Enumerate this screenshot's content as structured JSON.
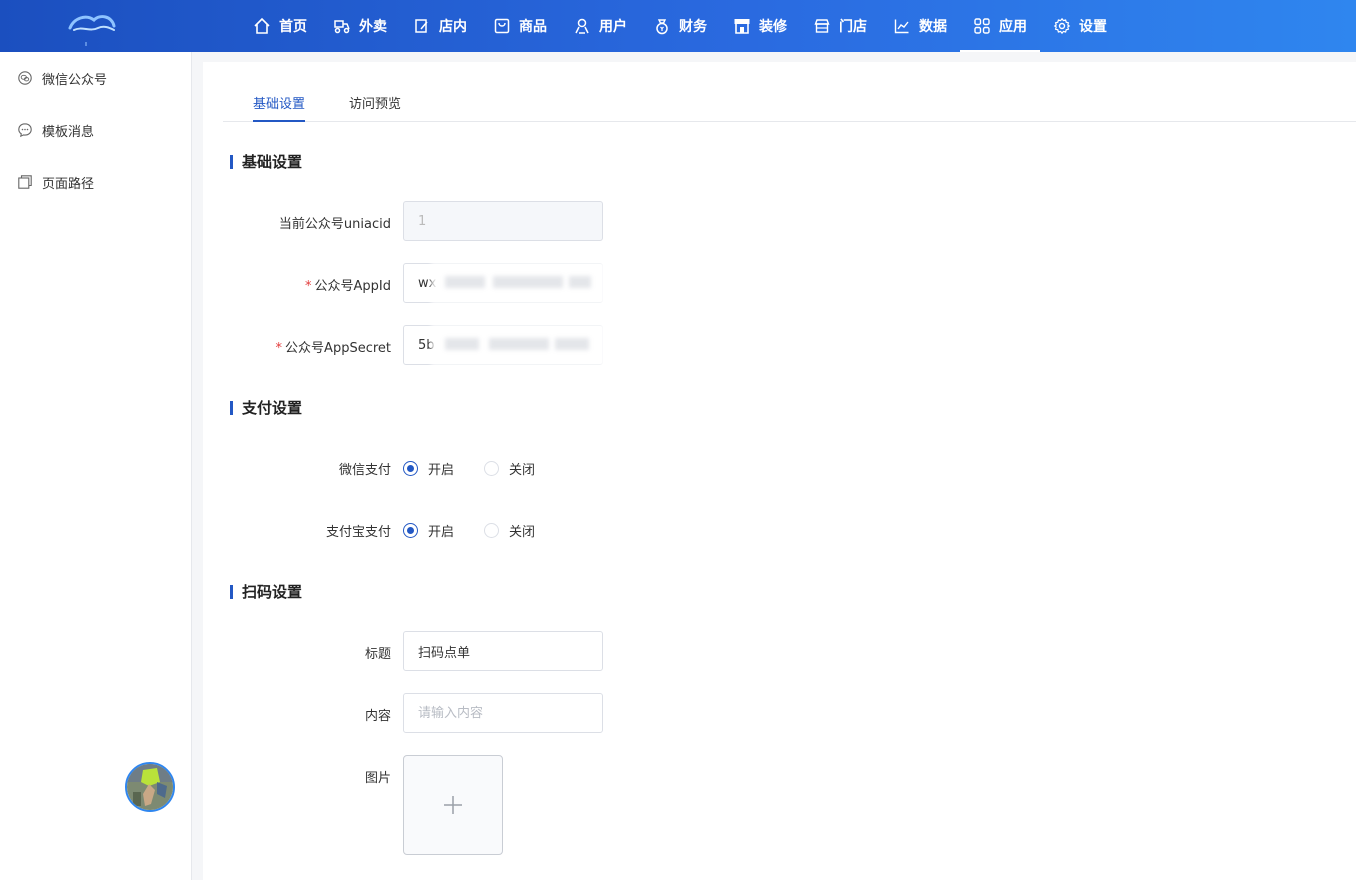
{
  "nav": {
    "items": [
      {
        "label": "首页",
        "icon": "home-icon"
      },
      {
        "label": "外卖",
        "icon": "bike-icon"
      },
      {
        "label": "店内",
        "icon": "edit-icon"
      },
      {
        "label": "商品",
        "icon": "bag-icon"
      },
      {
        "label": "用户",
        "icon": "user-icon"
      },
      {
        "label": "财务",
        "icon": "money-bag-icon"
      },
      {
        "label": "装修",
        "icon": "storefront-icon"
      },
      {
        "label": "门店",
        "icon": "shop-icon"
      },
      {
        "label": "数据",
        "icon": "chart-icon"
      },
      {
        "label": "应用",
        "icon": "grid-icon"
      },
      {
        "label": "设置",
        "icon": "gear-icon"
      }
    ],
    "active": "应用"
  },
  "sidebar": {
    "items": [
      {
        "label": "微信公众号",
        "icon": "wechat-icon"
      },
      {
        "label": "模板消息",
        "icon": "message-icon"
      },
      {
        "label": "页面路径",
        "icon": "pages-icon"
      }
    ]
  },
  "tabs": {
    "basic": "基础设置",
    "preview": "访问预览"
  },
  "sections": {
    "basic": "基础设置",
    "payment": "支付设置",
    "scan": "扫码设置"
  },
  "fields": {
    "uniacid_label": "当前公众号uniacid",
    "uniacid_value": "1",
    "appid_label": "公众号AppId",
    "appid_value": "wx",
    "appsecret_label": "公众号AppSecret",
    "appsecret_value": "5b",
    "wechat_pay_label": "微信支付",
    "alipay_label": "支付宝支付",
    "on_label": "开启",
    "off_label": "关闭",
    "title_label": "标题",
    "title_value": "扫码点单",
    "content_label": "内容",
    "content_placeholder": "请输入内容",
    "image_label": "图片"
  },
  "required_mark": "*",
  "colors": {
    "accent": "#2358c4",
    "header_start": "#1b4fbf",
    "header_end": "#2f86ef",
    "required": "#e23b3b"
  }
}
